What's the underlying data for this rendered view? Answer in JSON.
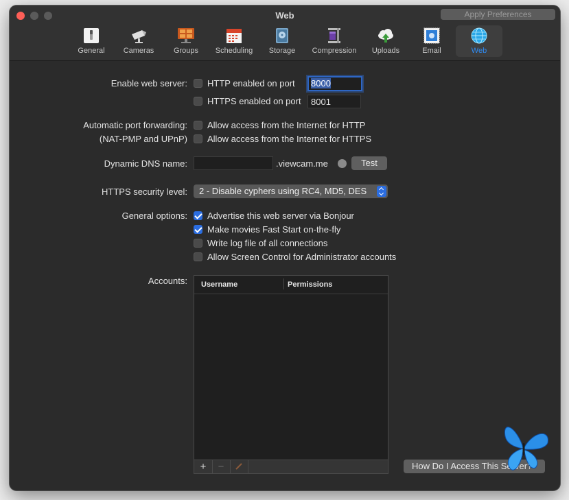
{
  "window": {
    "title": "Web",
    "apply_label": "Apply Preferences"
  },
  "tabs": [
    {
      "label": "General",
      "icon": "switch-icon"
    },
    {
      "label": "Cameras",
      "icon": "camera-icon"
    },
    {
      "label": "Groups",
      "icon": "grid-icon"
    },
    {
      "label": "Scheduling",
      "icon": "calendar-icon"
    },
    {
      "label": "Storage",
      "icon": "disk-icon"
    },
    {
      "label": "Compression",
      "icon": "clamp-icon"
    },
    {
      "label": "Uploads",
      "icon": "cloud-upload-icon"
    },
    {
      "label": "Email",
      "icon": "stamp-icon"
    },
    {
      "label": "Web",
      "icon": "globe-icon",
      "active": true
    }
  ],
  "web_server": {
    "label": "Enable web server:",
    "http": {
      "label": "HTTP enabled on port",
      "checked": false,
      "port": "8000"
    },
    "https": {
      "label": "HTTPS enabled on port",
      "checked": false,
      "port": "8001"
    }
  },
  "port_forwarding": {
    "label_line1": "Automatic port forwarding:",
    "label_line2": "(NAT-PMP and UPnP)",
    "http": {
      "label": "Allow access from the Internet for HTTP",
      "checked": false
    },
    "https": {
      "label": "Allow access from the Internet for HTTPS",
      "checked": false
    }
  },
  "ddns": {
    "label": "Dynamic DNS name:",
    "value": "",
    "suffix": ".viewcam.me",
    "test_label": "Test"
  },
  "security": {
    "label": "HTTPS security level:",
    "selected": "2 - Disable cyphers using RC4, MD5, DES"
  },
  "general_options": {
    "label": "General options:",
    "items": [
      {
        "label": "Advertise this web server via Bonjour",
        "checked": true
      },
      {
        "label": "Make movies Fast Start on-the-fly",
        "checked": true
      },
      {
        "label": "Write log file of all connections",
        "checked": false
      },
      {
        "label": "Allow Screen Control for Administrator accounts",
        "checked": false
      }
    ]
  },
  "accounts": {
    "label": "Accounts:",
    "columns": [
      "Username",
      "Permissions"
    ],
    "add": "+",
    "remove": "−",
    "help_label": "How Do I Access This Server?"
  },
  "colors": {
    "accent": "#2f8cf4",
    "checkbox_on": "#2b6de0",
    "close": "#fe5f57"
  }
}
